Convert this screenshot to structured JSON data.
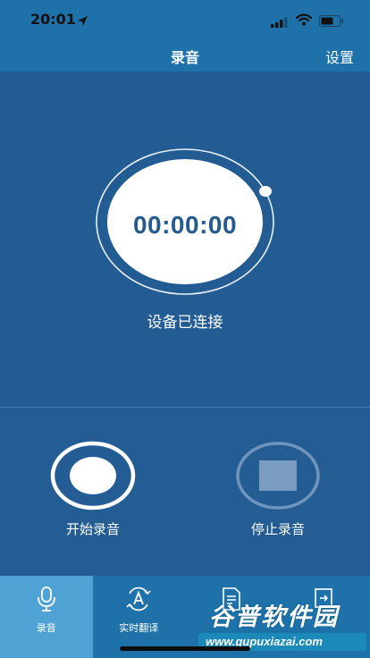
{
  "status_bar": {
    "time": "20:01"
  },
  "nav": {
    "title": "录音",
    "settings_label": "设置"
  },
  "timer": {
    "display": "00:00:00",
    "connection_status": "设备已连接"
  },
  "controls": {
    "start_label": "开始录音",
    "stop_label": "停止录音"
  },
  "tabs": [
    {
      "label": "录音",
      "icon": "microphone-icon",
      "active": true
    },
    {
      "label": "实时翻译",
      "icon": "translate-icon",
      "active": false
    },
    {
      "label": "",
      "icon": "document-icon",
      "active": false
    },
    {
      "label": "",
      "icon": "export-icon",
      "active": false
    }
  ],
  "watermark": {
    "text": "谷普软件园",
    "url": "www.gupuxiazai.com"
  },
  "colors": {
    "background": "#215b92",
    "nav_bar": "#1f72a9",
    "active_tab": "#4fa3d4",
    "timer_text": "#235a90"
  }
}
